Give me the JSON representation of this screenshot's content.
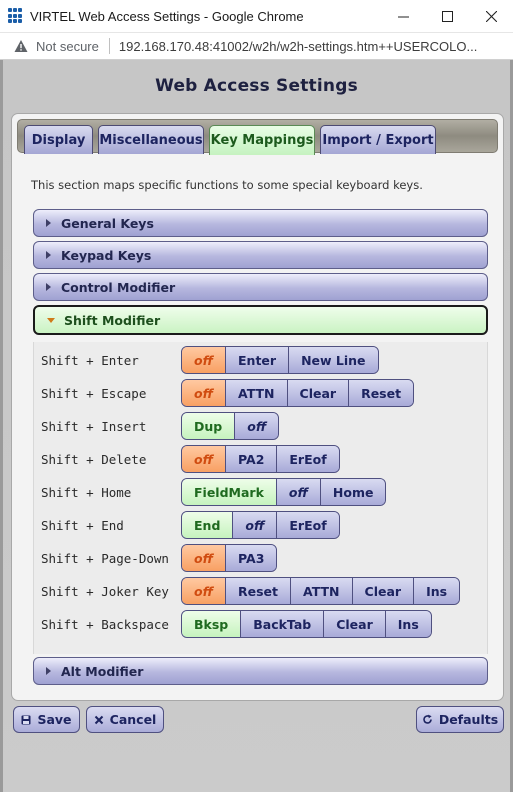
{
  "window": {
    "title": "VIRTEL Web Access Settings - Google Chrome",
    "minimize_glyph": "—",
    "maximize_glyph": "☐",
    "close_glyph": "✕"
  },
  "address": {
    "security_label": "Not secure",
    "url": "192.168.170.48:41002/w2h/w2h-settings.htm++USERCOLO..."
  },
  "page": {
    "title": "Web Access Settings"
  },
  "tabs": [
    {
      "label": "Display"
    },
    {
      "label": "Miscellaneous"
    },
    {
      "label": "Key Mappings"
    },
    {
      "label": "Import / Export"
    }
  ],
  "intro_text": "This section maps specific functions to some special keyboard keys.",
  "sections": [
    {
      "label": "General Keys"
    },
    {
      "label": "Keypad Keys"
    },
    {
      "label": "Control Modifier"
    },
    {
      "label": "Shift Modifier"
    },
    {
      "label": "Alt Modifier"
    }
  ],
  "shift_mappings": [
    {
      "key": "Shift + Enter",
      "options": [
        "off",
        "Enter",
        "New Line"
      ]
    },
    {
      "key": "Shift + Escape",
      "options": [
        "off",
        "ATTN",
        "Clear",
        "Reset"
      ]
    },
    {
      "key": "Shift + Insert",
      "options": [
        "Dup",
        "off"
      ]
    },
    {
      "key": "Shift + Delete",
      "options": [
        "off",
        "PA2",
        "ErEof"
      ]
    },
    {
      "key": "Shift + Home",
      "options": [
        "FieldMark",
        "off",
        "Home"
      ]
    },
    {
      "key": "Shift + End",
      "options": [
        "End",
        "off",
        "ErEof"
      ]
    },
    {
      "key": "Shift + Page-Down",
      "options": [
        "off",
        "PA3"
      ]
    },
    {
      "key": "Shift + Joker Key",
      "options": [
        "off",
        "Reset",
        "ATTN",
        "Clear",
        "Ins"
      ]
    },
    {
      "key": "Shift + Backspace",
      "options": [
        "Bksp",
        "BackTab",
        "Clear",
        "Ins"
      ]
    }
  ],
  "buttons": {
    "save": "Save",
    "cancel": "Cancel",
    "defaults": "Defaults"
  },
  "colors": {
    "selected_off": "#f8a063",
    "selected_value": "#c6f3be",
    "button_accent": "#a8aad8"
  }
}
